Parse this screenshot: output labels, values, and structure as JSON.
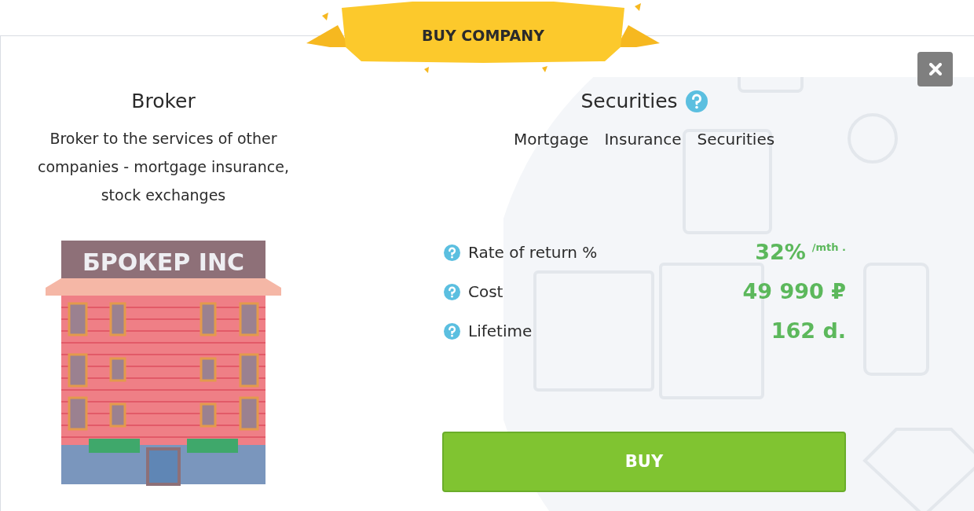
{
  "banner": {
    "title": "BUY COMPANY"
  },
  "company": {
    "name": "Broker",
    "description": "Broker to the services of other companies - mortgage insurance, stock exchanges",
    "sign": "БРОКЕР INC"
  },
  "category": {
    "title": "Securities",
    "links": [
      "Mortgage",
      "Insurance",
      "Securities"
    ]
  },
  "stats": [
    {
      "label": "Rate of return %",
      "value": "32%",
      "unit": "/mth ."
    },
    {
      "label": "Cost",
      "value": "49 990 ₽"
    },
    {
      "label": "Lifetime",
      "value": "162 d."
    }
  ],
  "buy_button": "BUY"
}
